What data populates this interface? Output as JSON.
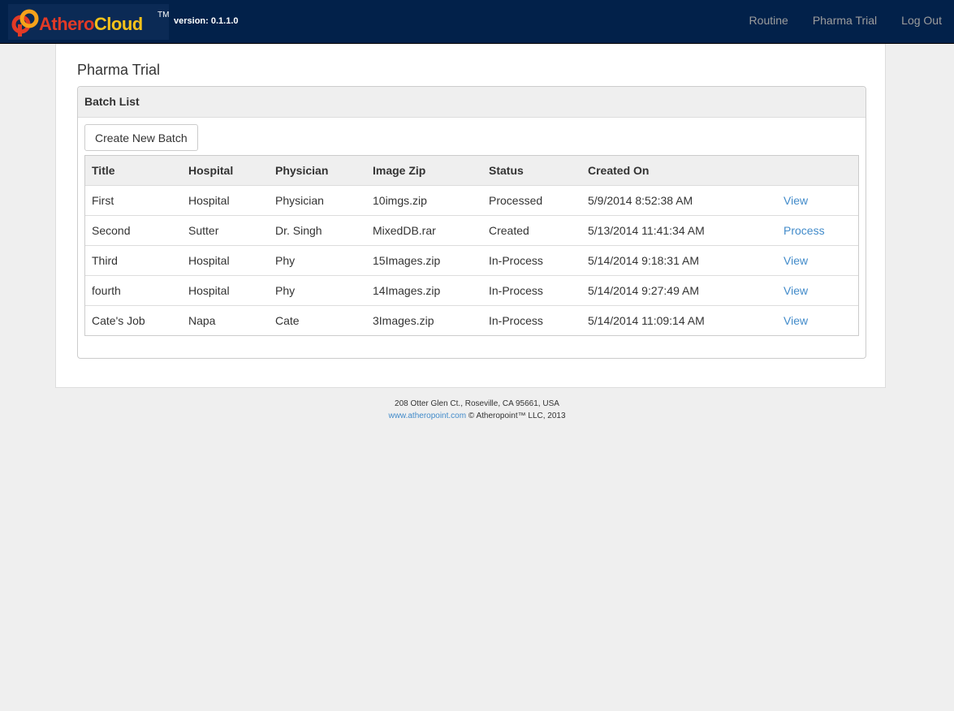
{
  "header": {
    "logo_text_1": "Athero",
    "logo_text_2": "Cloud",
    "logo_tm": "TM",
    "version": "version: 0.1.1.0",
    "nav": [
      {
        "label": "Routine"
      },
      {
        "label": "Pharma Trial"
      },
      {
        "label": "Log Out"
      }
    ]
  },
  "page": {
    "title": "Pharma Trial",
    "panel_title": "Batch List",
    "create_button": "Create New Batch"
  },
  "table": {
    "columns": [
      "Title",
      "Hospital",
      "Physician",
      "Image Zip",
      "Status",
      "Created On",
      ""
    ],
    "rows": [
      {
        "title": "First",
        "hospital": "Hospital",
        "physician": "Physician",
        "zip": "10imgs.zip",
        "status": "Processed",
        "created": "5/9/2014 8:52:38 AM",
        "action": "View"
      },
      {
        "title": "Second",
        "hospital": "Sutter",
        "physician": "Dr. Singh",
        "zip": "MixedDB.rar",
        "status": "Created",
        "created": "5/13/2014 11:41:34 AM",
        "action": "Process"
      },
      {
        "title": "Third",
        "hospital": "Hospital",
        "physician": "Phy",
        "zip": "15Images.zip",
        "status": "In-Process",
        "created": "5/14/2014 9:18:31 AM",
        "action": "View"
      },
      {
        "title": "fourth",
        "hospital": "Hospital",
        "physician": "Phy",
        "zip": "14Images.zip",
        "status": "In-Process",
        "created": "5/14/2014 9:27:49 AM",
        "action": "View"
      },
      {
        "title": "Cate's Job",
        "hospital": "Napa",
        "physician": "Cate",
        "zip": "3Images.zip",
        "status": "In-Process",
        "created": "5/14/2014 11:09:14 AM",
        "action": "View"
      }
    ]
  },
  "footer": {
    "address": "208 Otter Glen Ct., Roseville, CA 95661, USA",
    "link": "www.atheropoint.com",
    "copyright": "© Atheropoint™ LLC, 2013"
  },
  "colors": {
    "navbar": "#02214a",
    "link": "#428bca",
    "logo_red": "#e23a26",
    "logo_yellow": "#f6c21a"
  }
}
